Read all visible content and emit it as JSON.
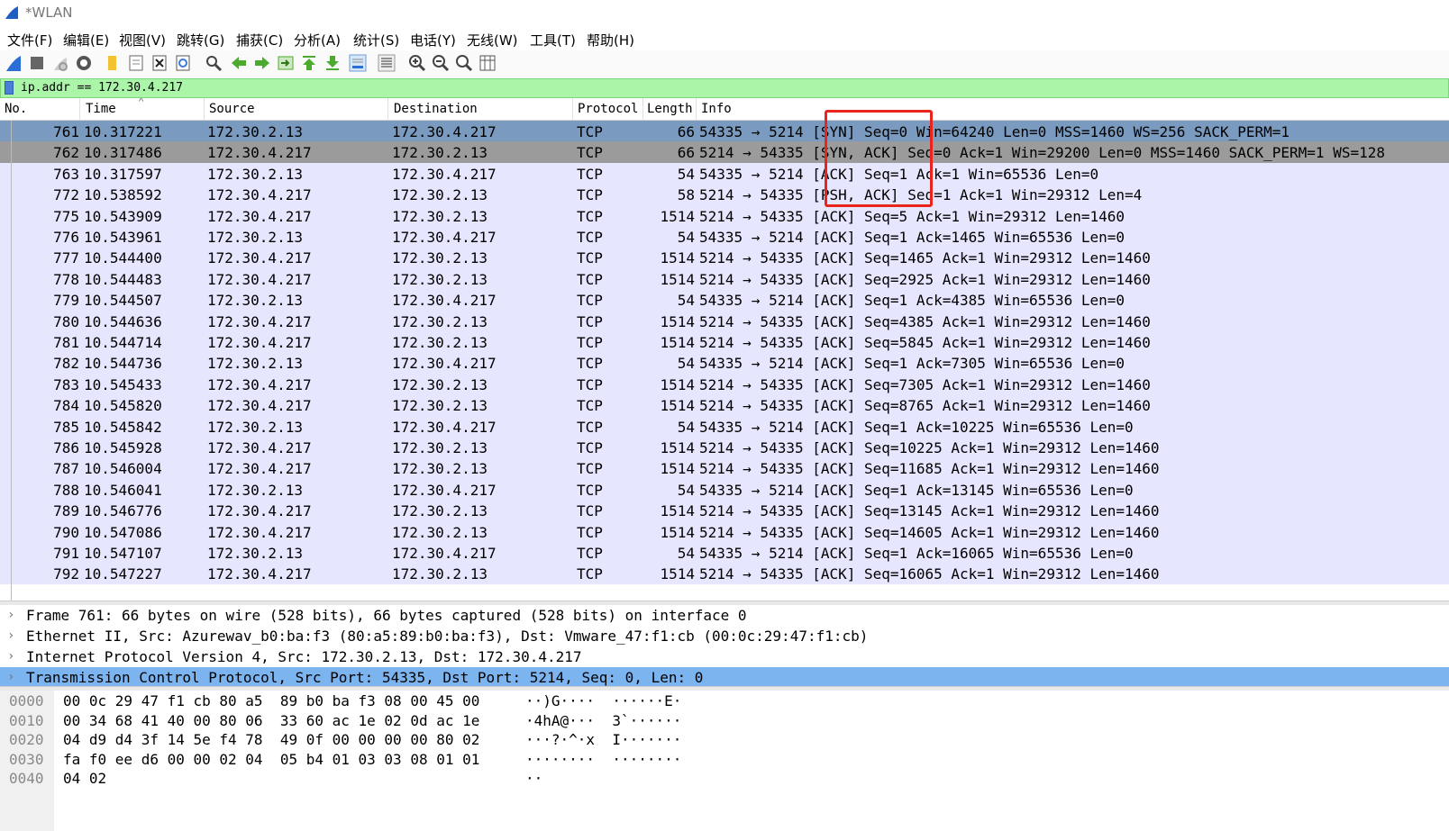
{
  "window": {
    "title": "*WLAN"
  },
  "menu": [
    "文件(F)",
    "编辑(E)",
    "视图(V)",
    "跳转(G)",
    "捕获(C)",
    "分析(A)",
    "统计(S)",
    "电话(Y)",
    "无线(W)",
    "工具(T)",
    "帮助(H)"
  ],
  "toolbar": {
    "icons": [
      "start-capture-icon",
      "stop-capture-icon",
      "restart-capture-icon",
      "capture-options-icon",
      "open-file-icon",
      "save-file-icon",
      "close-file-icon",
      "reload-file-icon",
      "find-packet-icon",
      "go-back-icon",
      "go-forward-icon",
      "go-to-packet-icon",
      "go-first-packet-icon",
      "go-last-packet-icon",
      "autoscroll-icon",
      "colorize-icon",
      "zoom-in-icon",
      "zoom-out-icon",
      "zoom-normal-icon",
      "resize-columns-icon"
    ]
  },
  "filter": {
    "value": "ip.addr == 172.30.4.217"
  },
  "packet_list": {
    "columns": [
      "No.",
      "Time",
      "Source",
      "Destination",
      "Protocol",
      "Length",
      "Info"
    ],
    "rows": [
      {
        "no": "761",
        "time": "10.317221",
        "src": "172.30.2.13",
        "dst": "172.30.4.217",
        "proto": "TCP",
        "len": "66",
        "info": "54335 → 5214 [SYN] Seq=0 Win=64240 Len=0 MSS=1460 WS=256 SACK_PERM=1"
      },
      {
        "no": "762",
        "time": "10.317486",
        "src": "172.30.4.217",
        "dst": "172.30.2.13",
        "proto": "TCP",
        "len": "66",
        "info": "5214 → 54335 [SYN, ACK] Seq=0 Ack=1 Win=29200 Len=0 MSS=1460 SACK_PERM=1 WS=128"
      },
      {
        "no": "763",
        "time": "10.317597",
        "src": "172.30.2.13",
        "dst": "172.30.4.217",
        "proto": "TCP",
        "len": "54",
        "info": "54335 → 5214 [ACK] Seq=1 Ack=1 Win=65536 Len=0"
      },
      {
        "no": "772",
        "time": "10.538592",
        "src": "172.30.4.217",
        "dst": "172.30.2.13",
        "proto": "TCP",
        "len": "58",
        "info": "5214 → 54335 [PSH, ACK] Seq=1 Ack=1 Win=29312 Len=4"
      },
      {
        "no": "775",
        "time": "10.543909",
        "src": "172.30.4.217",
        "dst": "172.30.2.13",
        "proto": "TCP",
        "len": "1514",
        "info": "5214 → 54335 [ACK] Seq=5 Ack=1 Win=29312 Len=1460"
      },
      {
        "no": "776",
        "time": "10.543961",
        "src": "172.30.2.13",
        "dst": "172.30.4.217",
        "proto": "TCP",
        "len": "54",
        "info": "54335 → 5214 [ACK] Seq=1 Ack=1465 Win=65536 Len=0"
      },
      {
        "no": "777",
        "time": "10.544400",
        "src": "172.30.4.217",
        "dst": "172.30.2.13",
        "proto": "TCP",
        "len": "1514",
        "info": "5214 → 54335 [ACK] Seq=1465 Ack=1 Win=29312 Len=1460"
      },
      {
        "no": "778",
        "time": "10.544483",
        "src": "172.30.4.217",
        "dst": "172.30.2.13",
        "proto": "TCP",
        "len": "1514",
        "info": "5214 → 54335 [ACK] Seq=2925 Ack=1 Win=29312 Len=1460"
      },
      {
        "no": "779",
        "time": "10.544507",
        "src": "172.30.2.13",
        "dst": "172.30.4.217",
        "proto": "TCP",
        "len": "54",
        "info": "54335 → 5214 [ACK] Seq=1 Ack=4385 Win=65536 Len=0"
      },
      {
        "no": "780",
        "time": "10.544636",
        "src": "172.30.4.217",
        "dst": "172.30.2.13",
        "proto": "TCP",
        "len": "1514",
        "info": "5214 → 54335 [ACK] Seq=4385 Ack=1 Win=29312 Len=1460"
      },
      {
        "no": "781",
        "time": "10.544714",
        "src": "172.30.4.217",
        "dst": "172.30.2.13",
        "proto": "TCP",
        "len": "1514",
        "info": "5214 → 54335 [ACK] Seq=5845 Ack=1 Win=29312 Len=1460"
      },
      {
        "no": "782",
        "time": "10.544736",
        "src": "172.30.2.13",
        "dst": "172.30.4.217",
        "proto": "TCP",
        "len": "54",
        "info": "54335 → 5214 [ACK] Seq=1 Ack=7305 Win=65536 Len=0"
      },
      {
        "no": "783",
        "time": "10.545433",
        "src": "172.30.4.217",
        "dst": "172.30.2.13",
        "proto": "TCP",
        "len": "1514",
        "info": "5214 → 54335 [ACK] Seq=7305 Ack=1 Win=29312 Len=1460"
      },
      {
        "no": "784",
        "time": "10.545820",
        "src": "172.30.4.217",
        "dst": "172.30.2.13",
        "proto": "TCP",
        "len": "1514",
        "info": "5214 → 54335 [ACK] Seq=8765 Ack=1 Win=29312 Len=1460"
      },
      {
        "no": "785",
        "time": "10.545842",
        "src": "172.30.2.13",
        "dst": "172.30.4.217",
        "proto": "TCP",
        "len": "54",
        "info": "54335 → 5214 [ACK] Seq=1 Ack=10225 Win=65536 Len=0"
      },
      {
        "no": "786",
        "time": "10.545928",
        "src": "172.30.4.217",
        "dst": "172.30.2.13",
        "proto": "TCP",
        "len": "1514",
        "info": "5214 → 54335 [ACK] Seq=10225 Ack=1 Win=29312 Len=1460"
      },
      {
        "no": "787",
        "time": "10.546004",
        "src": "172.30.4.217",
        "dst": "172.30.2.13",
        "proto": "TCP",
        "len": "1514",
        "info": "5214 → 54335 [ACK] Seq=11685 Ack=1 Win=29312 Len=1460"
      },
      {
        "no": "788",
        "time": "10.546041",
        "src": "172.30.2.13",
        "dst": "172.30.4.217",
        "proto": "TCP",
        "len": "54",
        "info": "54335 → 5214 [ACK] Seq=1 Ack=13145 Win=65536 Len=0"
      },
      {
        "no": "789",
        "time": "10.546776",
        "src": "172.30.4.217",
        "dst": "172.30.2.13",
        "proto": "TCP",
        "len": "1514",
        "info": "5214 → 54335 [ACK] Seq=13145 Ack=1 Win=29312 Len=1460"
      },
      {
        "no": "790",
        "time": "10.547086",
        "src": "172.30.4.217",
        "dst": "172.30.2.13",
        "proto": "TCP",
        "len": "1514",
        "info": "5214 → 54335 [ACK] Seq=14605 Ack=1 Win=29312 Len=1460"
      },
      {
        "no": "791",
        "time": "10.547107",
        "src": "172.30.2.13",
        "dst": "172.30.4.217",
        "proto": "TCP",
        "len": "54",
        "info": "54335 → 5214 [ACK] Seq=1 Ack=16065 Win=65536 Len=0"
      },
      {
        "no": "792",
        "time": "10.547227",
        "src": "172.30.4.217",
        "dst": "172.30.2.13",
        "proto": "TCP",
        "len": "1514",
        "info": "5214 → 54335 [ACK] Seq=16065 Ack=1 Win=29312 Len=1460"
      }
    ]
  },
  "details": [
    "Frame 761: 66 bytes on wire (528 bits), 66 bytes captured (528 bits) on interface 0",
    "Ethernet II, Src: Azurewav_b0:ba:f3 (80:a5:89:b0:ba:f3), Dst: Vmware_47:f1:cb (00:0c:29:47:f1:cb)",
    "Internet Protocol Version 4, Src: 172.30.2.13, Dst: 172.30.4.217",
    "Transmission Control Protocol, Src Port: 54335, Dst Port: 5214, Seq: 0, Len: 0"
  ],
  "bytes": [
    {
      "off": "0000",
      "hex": "00 0c 29 47 f1 cb 80 a5  89 b0 ba f3 08 00 45 00",
      "ascii": "··)G····  ······E·"
    },
    {
      "off": "0010",
      "hex": "00 34 68 41 40 00 80 06  33 60 ac 1e 02 0d ac 1e",
      "ascii": "·4hA@···  3`······"
    },
    {
      "off": "0020",
      "hex": "04 d9 d4 3f 14 5e f4 78  49 0f 00 00 00 00 80 02",
      "ascii": "···?·^·x  I·······"
    },
    {
      "off": "0030",
      "hex": "fa f0 ee d6 00 00 02 04  05 b4 01 03 03 08 01 01",
      "ascii": "········  ········"
    },
    {
      "off": "0040",
      "hex": "04 02",
      "ascii": "··"
    }
  ],
  "colors": {
    "row_bg": "#e7e6ff",
    "selected_row": "#7a9bbf",
    "filter_bg": "#aaf5a8",
    "highlight_box": "#e8241c"
  }
}
